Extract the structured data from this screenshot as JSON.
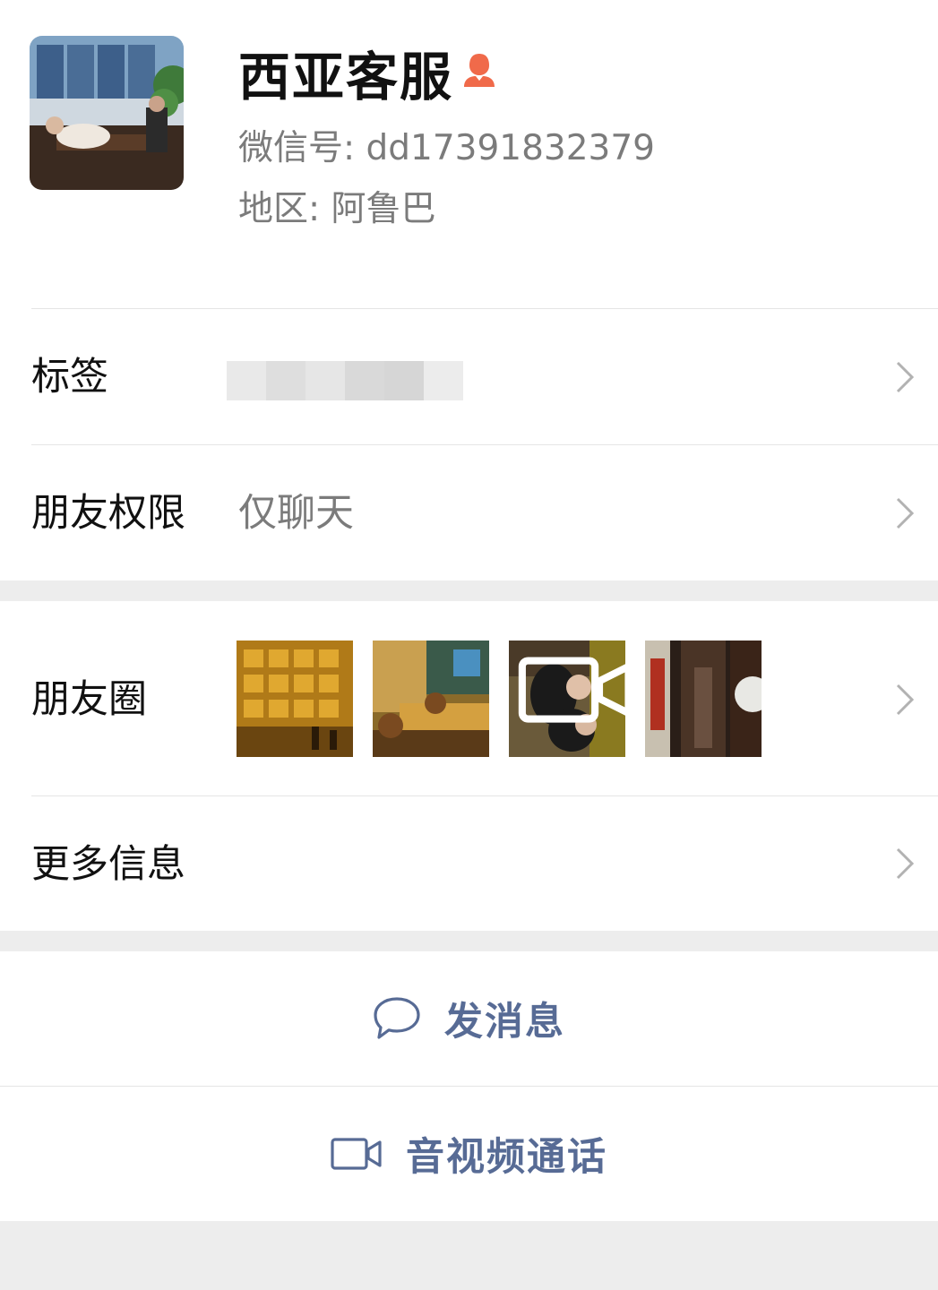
{
  "profile": {
    "name": "西亚客服",
    "wechat_id": "微信号: dd17391832379",
    "region": "地区: 阿鲁巴",
    "badge_icon": "service-agent-icon",
    "badge_color": "#f06a4a"
  },
  "rows": {
    "tags": {
      "label": "标签"
    },
    "permissions": {
      "label": "朋友权限",
      "value": "仅聊天"
    },
    "moments": {
      "label": "朋友圈",
      "thumbnail_count": 4,
      "video_thumbnail_index": 2
    },
    "more_info": {
      "label": "更多信息"
    }
  },
  "actions": {
    "message": {
      "label": "发消息",
      "icon": "chat-bubble-icon"
    },
    "call": {
      "label": "音视频通话",
      "icon": "video-camera-icon"
    }
  },
  "colors": {
    "link": "#576b95",
    "secondary_text": "#7b7b7b",
    "background": "#ededed"
  }
}
